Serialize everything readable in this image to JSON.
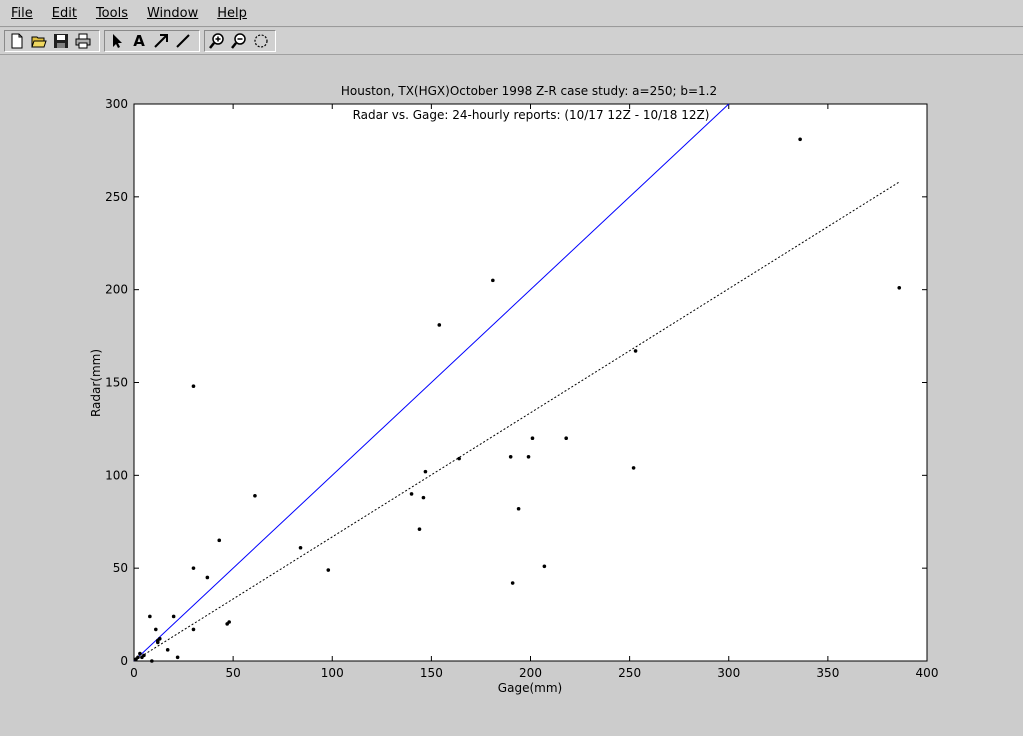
{
  "menu": [
    "File",
    "Edit",
    "Tools",
    "Window",
    "Help"
  ],
  "toolbar": {
    "tools": [
      {
        "name": "new-file-icon",
        "icon": "new"
      },
      {
        "name": "open-file-icon",
        "icon": "open"
      },
      {
        "name": "save-icon",
        "icon": "save"
      },
      {
        "name": "print-icon",
        "icon": "print"
      },
      {
        "name": "select-arrow-icon",
        "icon": "arrow"
      },
      {
        "name": "insert-text-icon",
        "icon": "A"
      },
      {
        "name": "insert-arrow-icon",
        "icon": "diag-arrow"
      },
      {
        "name": "insert-line-icon",
        "icon": "line"
      },
      {
        "name": "zoom-in-icon",
        "icon": "zoom-in"
      },
      {
        "name": "zoom-out-icon",
        "icon": "zoom-out"
      },
      {
        "name": "rotate-icon",
        "icon": "rotate"
      }
    ]
  },
  "chart_data": {
    "type": "scatter",
    "title": "Houston, TX(HGX)October 1998 Z-R case study: a=250; b=1.2",
    "subtitle": "Radar vs. Gage: 24-hourly reports: (10/17 12Z - 10/18 12Z)",
    "xlabel": "Gage(mm)",
    "ylabel": "Radar(mm)",
    "xlim": [
      0,
      400
    ],
    "ylim": [
      0,
      300
    ],
    "xticks": [
      0,
      50,
      100,
      150,
      200,
      250,
      300,
      350,
      400
    ],
    "yticks": [
      0,
      50,
      100,
      150,
      200,
      250,
      300
    ],
    "grid": false,
    "marker_color": "#000000",
    "points": [
      [
        1,
        1
      ],
      [
        2,
        2
      ],
      [
        3,
        4
      ],
      [
        4,
        2
      ],
      [
        5,
        3
      ],
      [
        8,
        24
      ],
      [
        9,
        0
      ],
      [
        11,
        17
      ],
      [
        12,
        10
      ],
      [
        12,
        11
      ],
      [
        13,
        12
      ],
      [
        17,
        6
      ],
      [
        20,
        24
      ],
      [
        22,
        2
      ],
      [
        30,
        148
      ],
      [
        30,
        50
      ],
      [
        30,
        17
      ],
      [
        37,
        45
      ],
      [
        43,
        65
      ],
      [
        47,
        20
      ],
      [
        48,
        21
      ],
      [
        61,
        89
      ],
      [
        84,
        61
      ],
      [
        98,
        49
      ],
      [
        140,
        90
      ],
      [
        144,
        71
      ],
      [
        146,
        88
      ],
      [
        147,
        102
      ],
      [
        154,
        181
      ],
      [
        164,
        109
      ],
      [
        181,
        205
      ],
      [
        190,
        110
      ],
      [
        191,
        42
      ],
      [
        194,
        82
      ],
      [
        199,
        110
      ],
      [
        201,
        120
      ],
      [
        207,
        51
      ],
      [
        218,
        120
      ],
      [
        252,
        104
      ],
      [
        253,
        167
      ],
      [
        336,
        281
      ],
      [
        386,
        201
      ]
    ],
    "lines": [
      {
        "style": "solid",
        "color": "#0000ff",
        "x": [
          0,
          300
        ],
        "y": [
          0,
          300
        ]
      },
      {
        "style": "dotted",
        "color": "#000000",
        "x": [
          0,
          386
        ],
        "y": [
          0,
          258
        ]
      }
    ]
  }
}
